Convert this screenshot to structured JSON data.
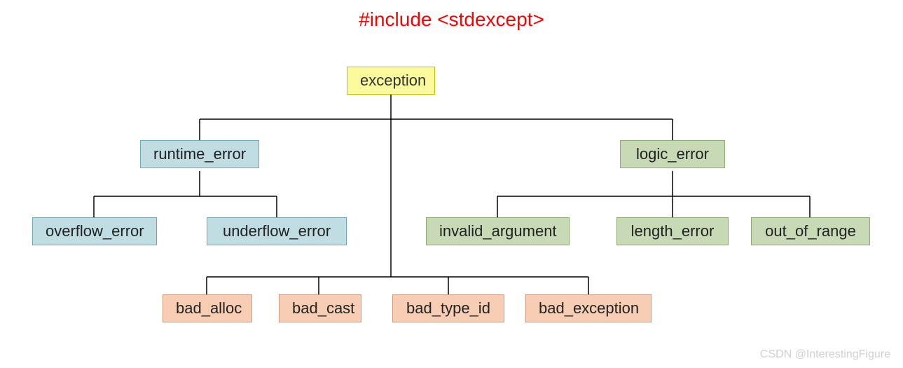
{
  "header": {
    "include_line": "#include <stdexcept>"
  },
  "nodes": {
    "exception": "exception",
    "runtime_error": "runtime_error",
    "logic_error": "logic_error",
    "overflow_error": "overflow_error",
    "underflow_error": "underflow_error",
    "invalid_argument": "invalid_argument",
    "length_error": "length_error",
    "out_of_range": "out_of_range",
    "bad_alloc": "bad_alloc",
    "bad_cast": "bad_cast",
    "bad_type_id": "bad_type_id",
    "bad_exception": "bad_exception"
  },
  "watermark": "CSDN @InterestingFigure",
  "chart_data": {
    "type": "diagram",
    "title": "#include <stdexcept>",
    "tree": {
      "name": "exception",
      "color": "yellow",
      "children": [
        {
          "name": "runtime_error",
          "color": "blue",
          "children": [
            {
              "name": "overflow_error",
              "color": "blue"
            },
            {
              "name": "underflow_error",
              "color": "blue"
            }
          ]
        },
        {
          "name": "logic_error",
          "color": "green",
          "children": [
            {
              "name": "invalid_argument",
              "color": "green"
            },
            {
              "name": "length_error",
              "color": "green"
            },
            {
              "name": "out_of_range",
              "color": "green"
            }
          ]
        },
        {
          "name": "bad_alloc",
          "color": "orange"
        },
        {
          "name": "bad_cast",
          "color": "orange"
        },
        {
          "name": "bad_type_id",
          "color": "orange"
        },
        {
          "name": "bad_exception",
          "color": "orange"
        }
      ]
    }
  }
}
